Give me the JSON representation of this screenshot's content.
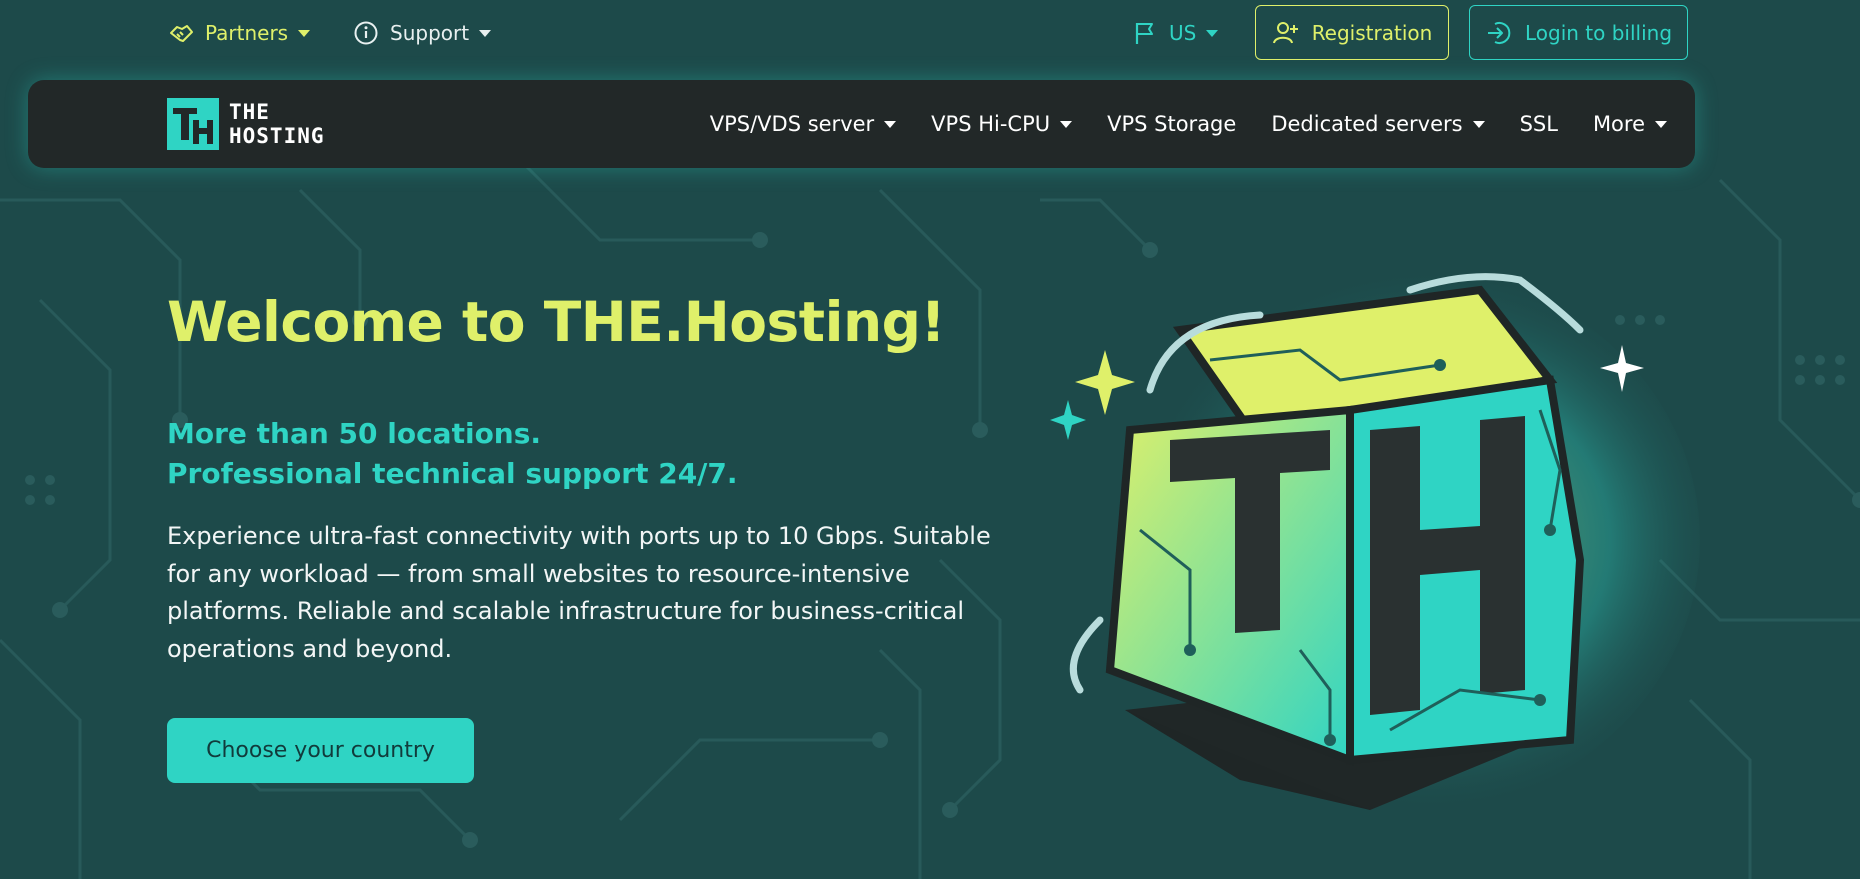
{
  "topbar": {
    "partners_label": "Partners",
    "support_label": "Support",
    "lang_label": "US",
    "registration_label": "Registration",
    "login_label": "Login to billing"
  },
  "navbar": {
    "logo_line1": "THE",
    "logo_line2": "HOSTING",
    "items": [
      {
        "label": "VPS/VDS server"
      },
      {
        "label": "VPS Hi-CPU"
      },
      {
        "label": "VPS Storage"
      },
      {
        "label": "Dedicated servers"
      },
      {
        "label": "SSL"
      },
      {
        "label": "More"
      }
    ]
  },
  "hero": {
    "title": "Welcome to THE.Hosting!",
    "subtitle_line1": "More than 50 locations.",
    "subtitle_line2": "Professional technical support 24/7.",
    "description": "Experience ultra-fast connectivity with ports up to 10 Gbps. Suitable for any workload — from small websites to resource-intensive platforms. Reliable and scalable infrastructure for business-critical operations and beyond.",
    "cta_label": "Choose your country"
  },
  "colors": {
    "background": "#1d4a4a",
    "accent_yellow": "#dff06a",
    "accent_teal": "#2fd4c4",
    "navbar_bg": "#222828"
  },
  "icons": {
    "partners": "handshake-icon",
    "support": "info-icon",
    "lang": "flag-icon",
    "registration": "user-plus-icon",
    "login": "login-arrow-icon"
  }
}
